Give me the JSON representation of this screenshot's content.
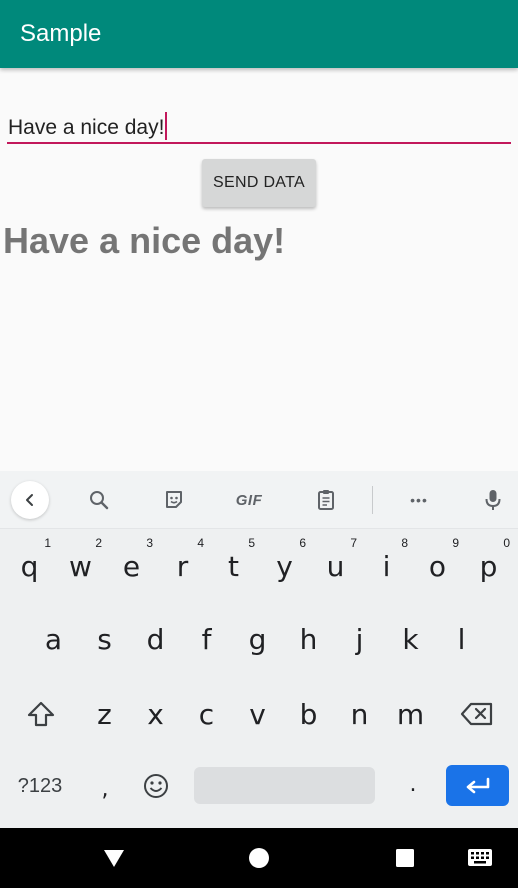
{
  "app": {
    "title": "Sample"
  },
  "form": {
    "input_value": "Have a nice day!",
    "send_label": "SEND DATA",
    "result_text": "Have a nice day!"
  },
  "keyboard": {
    "suggestion_icons": [
      "back-icon",
      "search-icon",
      "sticker-icon",
      "gif-icon",
      "clipboard-icon",
      "more-icon",
      "mic-icon"
    ],
    "gif_label": "GIF",
    "more_label": "•••",
    "row1": [
      {
        "letter": "q",
        "hint": "1"
      },
      {
        "letter": "w",
        "hint": "2"
      },
      {
        "letter": "e",
        "hint": "3"
      },
      {
        "letter": "r",
        "hint": "4"
      },
      {
        "letter": "t",
        "hint": "5"
      },
      {
        "letter": "y",
        "hint": "6"
      },
      {
        "letter": "u",
        "hint": "7"
      },
      {
        "letter": "i",
        "hint": "8"
      },
      {
        "letter": "o",
        "hint": "9"
      },
      {
        "letter": "p",
        "hint": "0"
      }
    ],
    "row2": [
      "a",
      "s",
      "d",
      "f",
      "g",
      "h",
      "j",
      "k",
      "l"
    ],
    "row3": [
      "z",
      "x",
      "c",
      "v",
      "b",
      "n",
      "m"
    ],
    "symbols_label": "?123",
    "comma": ",",
    "period": ".",
    "enter_color": "#1a73e8"
  },
  "colors": {
    "appbar": "#00897b",
    "accent": "#c2185b",
    "result_text": "#757575"
  }
}
